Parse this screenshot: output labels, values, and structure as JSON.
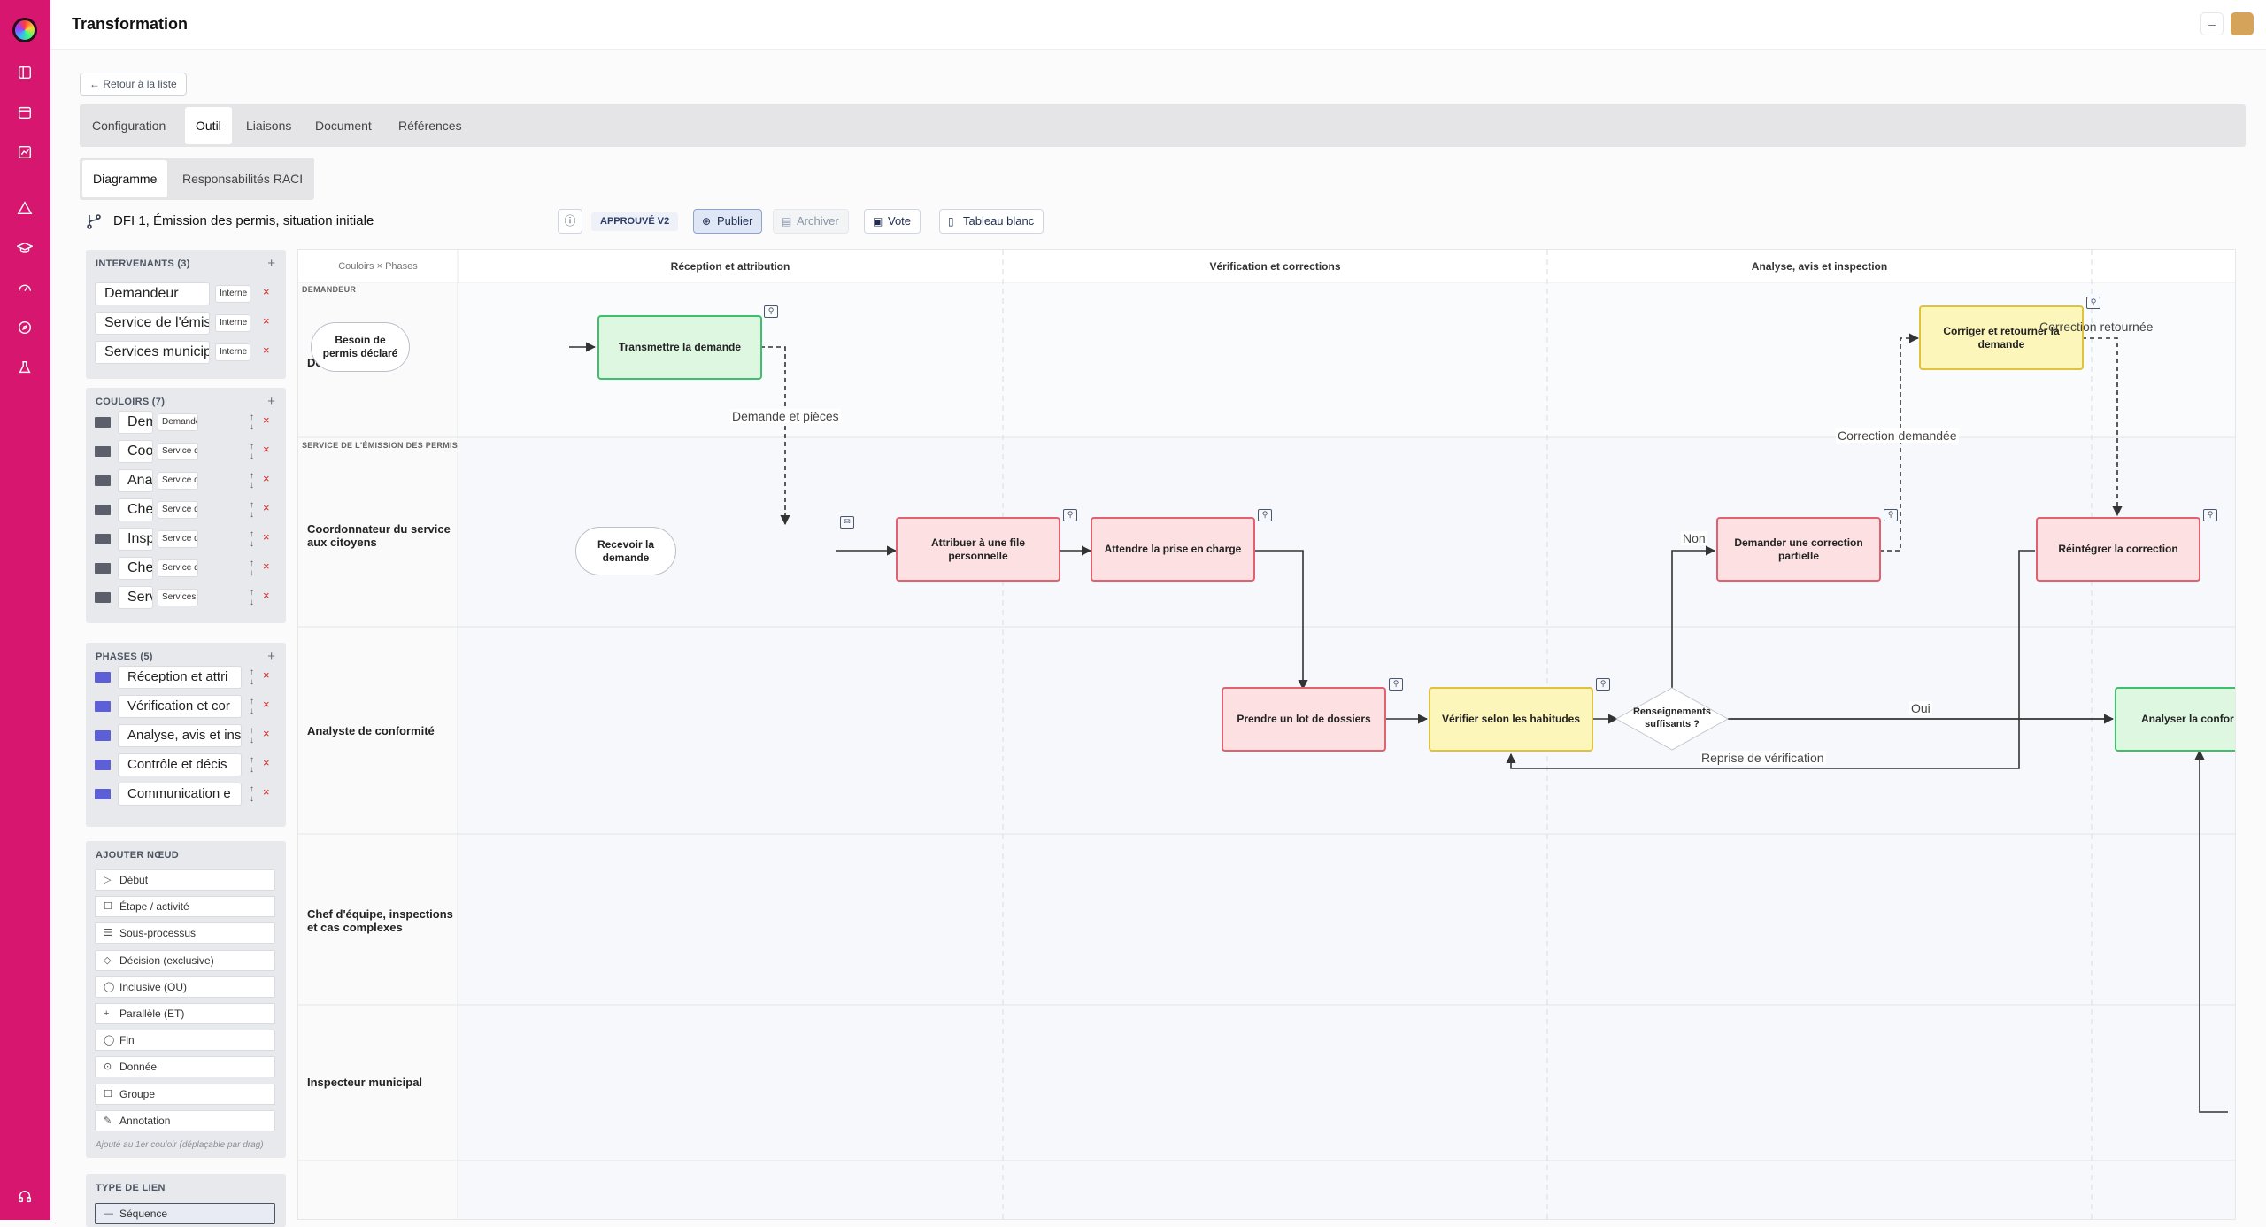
{
  "app": {
    "title": "Transformation"
  },
  "nav": {
    "back_label": "← Retour à la liste"
  },
  "tabs_main": [
    {
      "label": "Configuration"
    },
    {
      "label": "Outil"
    },
    {
      "label": "Liaisons"
    },
    {
      "label": "Document"
    },
    {
      "label": "Références"
    }
  ],
  "tabs_sub": [
    {
      "label": "Diagramme"
    },
    {
      "label": "Responsabilités RACI"
    }
  ],
  "process": {
    "name": "DFI 1, Émission des permis, situation initiale",
    "status_badge": "APPROUVÉ V2",
    "publish_label": "Publier",
    "archive_label": "Archiver",
    "vote_label": "Vote",
    "whiteboard_label": "Tableau blanc"
  },
  "intervenants": {
    "title": "INTERVENANTS (3)",
    "items": [
      {
        "name": "Demandeur",
        "type": "Interne"
      },
      {
        "name": "Service de l'émis",
        "type": "Interne"
      },
      {
        "name": "Services municip",
        "type": "Interne"
      }
    ]
  },
  "couloirs": {
    "title": "COULOIRS (7)",
    "items": [
      {
        "name": "Dema",
        "actor": "Demandeur",
        "color": "#5b5f6b"
      },
      {
        "name": "Coorc",
        "actor": "Service de l'ém",
        "color": "#5b5f6b"
      },
      {
        "name": "Analys",
        "actor": "Service de l'ém",
        "color": "#5b5f6b"
      },
      {
        "name": "Chef c",
        "actor": "Service de l'ém",
        "color": "#5b5f6b"
      },
      {
        "name": "Inspec",
        "actor": "Service de l'ém",
        "color": "#5b5f6b"
      },
      {
        "name": "Chef c",
        "actor": "Service de l'ém",
        "color": "#5b5f6b"
      },
      {
        "name": "Servic",
        "actor": "Services munic",
        "color": "#5b5f6b"
      }
    ]
  },
  "phases": {
    "title": "PHASES (5)",
    "items": [
      {
        "name": "Réception et attri",
        "color": "#5c5fd6"
      },
      {
        "name": "Vérification et cor",
        "color": "#5c5fd6"
      },
      {
        "name": "Analyse, avis et ins",
        "color": "#5c5fd6"
      },
      {
        "name": "Contrôle et décis",
        "color": "#5c5fd6"
      },
      {
        "name": "Communication e",
        "color": "#5c5fd6"
      }
    ]
  },
  "add_node": {
    "title": "AJOUTER NŒUD",
    "items": [
      {
        "label": "Début",
        "icon": "▷"
      },
      {
        "label": "Étape / activité",
        "icon": "☐"
      },
      {
        "label": "Sous-processus",
        "icon": "☰"
      },
      {
        "label": "Décision (exclusive)",
        "icon": "◇"
      },
      {
        "label": "Inclusive (OU)",
        "icon": "◯"
      },
      {
        "label": "Parallèle (ET)",
        "icon": "+"
      },
      {
        "label": "Fin",
        "icon": "◯"
      },
      {
        "label": "Donnée",
        "icon": "⊙"
      },
      {
        "label": "Groupe",
        "icon": "☐"
      },
      {
        "label": "Annotation",
        "icon": "✎"
      }
    ],
    "hint": "Ajouté au 1er couloir (déplaçable par drag)"
  },
  "link_type": {
    "title": "TYPE DE LIEN",
    "selected": "Séquence"
  },
  "diagram": {
    "corner_label": "Couloirs × Phases",
    "phases": [
      "Réception et attribution",
      "Vérification et corrections",
      "Analyse, avis et inspection"
    ],
    "lanes": [
      {
        "caption": "DEMANDEUR",
        "label": "Demandeur"
      },
      {
        "caption": "SERVICE DE L'ÉMISSION DES PERMIS",
        "label": "Coordonnateur du service aux citoyens"
      },
      {
        "caption": "",
        "label": "Analyste de conformité"
      },
      {
        "caption": "",
        "label": "Chef d'équipe, inspections et cas complexes"
      },
      {
        "caption": "",
        "label": "Inspecteur municipal"
      }
    ],
    "nodes": {
      "n1": "Besoin de permis déclaré",
      "n2": "Transmettre la demande",
      "n3": "Recevoir la demande",
      "n4": "Attribuer à une file personnelle",
      "n5": "Attendre la prise en charge",
      "n6": "Prendre un lot de dossiers",
      "n7": "Vérifier selon les habitudes",
      "n8": "Renseignements suffisants ?",
      "n9": "Demander une correction partielle",
      "n10": "Corriger et retourner la demande",
      "n11": "Réintégrer la correction",
      "n12": "Analyser la confor"
    },
    "edge_labels": {
      "e1": "Demande et pièces",
      "e2": "Non",
      "e3": "Oui",
      "e4": "Correction demandée",
      "e5": "Correction retournée",
      "e6": "Reprise de vérification"
    }
  }
}
